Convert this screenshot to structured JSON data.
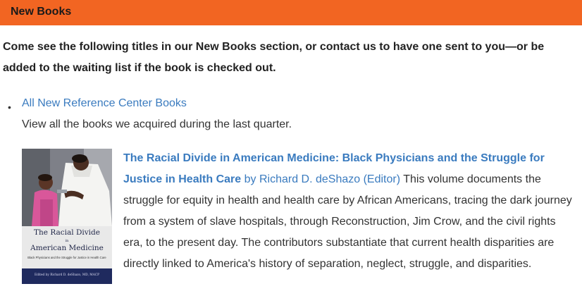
{
  "header": {
    "title": "New Books"
  },
  "intro": "Come see the following titles in our New Books section, or contact us to have one sent to you—or be added to the waiting list if the book is checked out.",
  "list": {
    "bullet": "•",
    "all_books": {
      "link_label": "All New Reference Center Books",
      "description": "View all the books we acquired during the last quarter."
    }
  },
  "book": {
    "title": "The Racial Divide in American Medicine: Black Physicians and the Struggle for Justice in Health Care",
    "by": "by Richard D. deShazo (Editor)",
    "description": "This volume documents the struggle for equity in health and health care by African Americans, tracing the dark journey from a system of slave hospitals, through Reconstruction, Jim Crow, and the civil rights era, to the present day. The contributors substantiate that current health disparities are directly linked to America's history of separation, neglect, struggle, and disparities.",
    "cover": {
      "title_line1": "The Racial Divide",
      "title_in": "in",
      "title_line2": "American Medicine",
      "subtitle": "Black Physicians and the Struggle for Justice in Health Care",
      "editors": "Edited by Richard D. deShazo, MD, MACP"
    }
  },
  "colors": {
    "header_bg": "#f26522",
    "link": "#3a7bbf",
    "cover_band": "#1f2a5e"
  }
}
